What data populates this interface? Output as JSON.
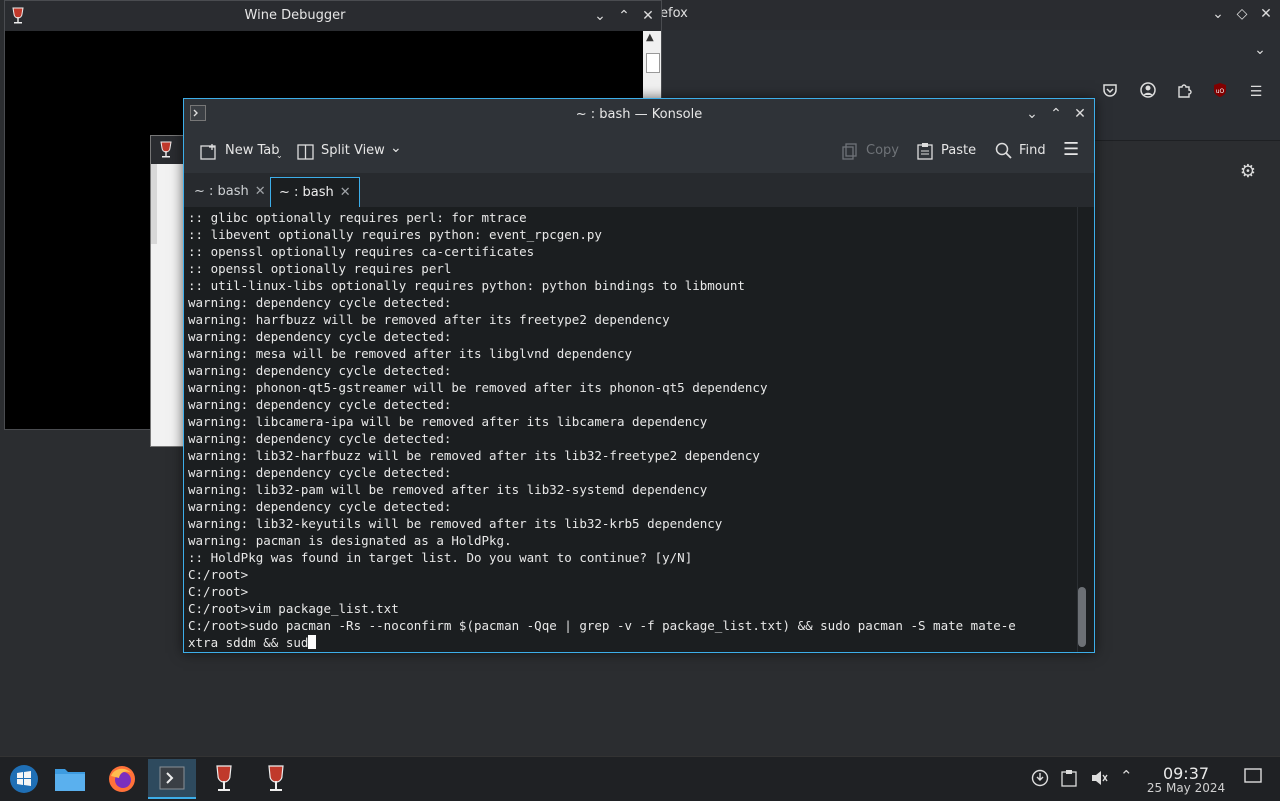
{
  "firefox": {
    "title_fragment": "efox",
    "gear_icon": "gear-icon",
    "toolbar_icons": [
      "pocket-icon",
      "account-icon",
      "extensions-icon",
      "ublock-icon",
      "menu-icon"
    ]
  },
  "wine_debugger": {
    "title": "Wine Debugger"
  },
  "konsole": {
    "title": "~ : bash — Konsole",
    "toolbar": {
      "new_tab": "New Tab",
      "split_view": "Split View",
      "copy": "Copy",
      "paste": "Paste",
      "find": "Find"
    },
    "tabs": [
      {
        "label": "~ : bash"
      },
      {
        "label": "~ : bash"
      }
    ],
    "terminal_lines": [
      ":: glibc optionally requires perl: for mtrace",
      ":: libevent optionally requires python: event_rpcgen.py",
      ":: openssl optionally requires ca-certificates",
      ":: openssl optionally requires perl",
      ":: util-linux-libs optionally requires python: python bindings to libmount",
      "warning: dependency cycle detected:",
      "warning: harfbuzz will be removed after its freetype2 dependency",
      "warning: dependency cycle detected:",
      "warning: mesa will be removed after its libglvnd dependency",
      "warning: dependency cycle detected:",
      "warning: phonon-qt5-gstreamer will be removed after its phonon-qt5 dependency",
      "warning: dependency cycle detected:",
      "warning: libcamera-ipa will be removed after its libcamera dependency",
      "warning: dependency cycle detected:",
      "warning: lib32-harfbuzz will be removed after its lib32-freetype2 dependency",
      "warning: dependency cycle detected:",
      "warning: lib32-pam will be removed after its lib32-systemd dependency",
      "warning: dependency cycle detected:",
      "warning: lib32-keyutils will be removed after its lib32-krb5 dependency",
      "warning: pacman is designated as a HoldPkg.",
      ":: HoldPkg was found in target list. Do you want to continue? [y/N]",
      "C:/root>",
      "C:/root>",
      "C:/root>vim package_list.txt",
      "C:/root>sudo pacman -Rs --noconfirm $(pacman -Qqe | grep -v -f package_list.txt) && sudo pacman -S mate mate-e"
    ],
    "input_line": "xtra sddm && sud"
  },
  "taskbar": {
    "apps": [
      "start-menu",
      "file-manager",
      "firefox",
      "konsole",
      "wine",
      "wine"
    ],
    "clock_time": "09:37",
    "clock_date": "25 May 2024"
  }
}
